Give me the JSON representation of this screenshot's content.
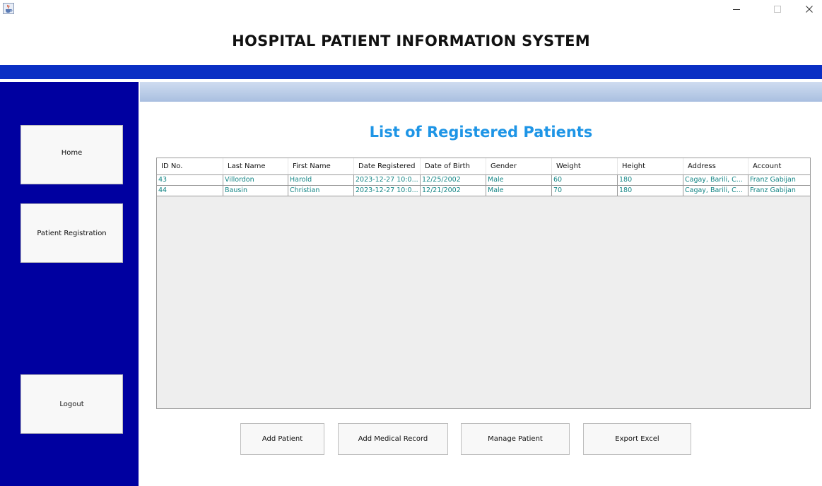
{
  "window": {
    "icon": "java-cup-icon",
    "controls": [
      "minimize-icon",
      "maximize-icon",
      "close-icon"
    ]
  },
  "header": {
    "title": "HOSPITAL PATIENT INFORMATION SYSTEM"
  },
  "sidebar": {
    "items": [
      {
        "label": "Home"
      },
      {
        "label": "Patient Registration"
      },
      {
        "label": "Logout"
      }
    ]
  },
  "main": {
    "title": "List of Registered Patients",
    "table": {
      "columns": [
        "ID No.",
        "Last Name",
        "First Name",
        "Date Registered",
        "Date of Birth",
        "Gender",
        "Weight",
        "Height",
        "Address",
        "Account"
      ],
      "rows": [
        [
          "43",
          "Villordon",
          "Harold",
          "2023-12-27 10:0...",
          "12/25/2002",
          "Male",
          "60",
          "180",
          "Cagay, Barili, C...",
          "Franz Gabijan"
        ],
        [
          "44",
          "Bausin",
          "Christian",
          "2023-12-27 10:0...",
          "12/21/2002",
          "Male",
          "70",
          "180",
          "Cagay, Barili, C...",
          "Franz Gabijan"
        ]
      ]
    },
    "actions": {
      "add_patient": "Add Patient",
      "add_medical_record": "Add Medical Record",
      "manage_patient": "Manage Patient",
      "export_excel": "Export Excel"
    }
  },
  "colors": {
    "sidebar": "#0000a0",
    "header_bar": "#0a2fc4",
    "title_accent": "#1e95e6",
    "table_text": "#138585"
  }
}
